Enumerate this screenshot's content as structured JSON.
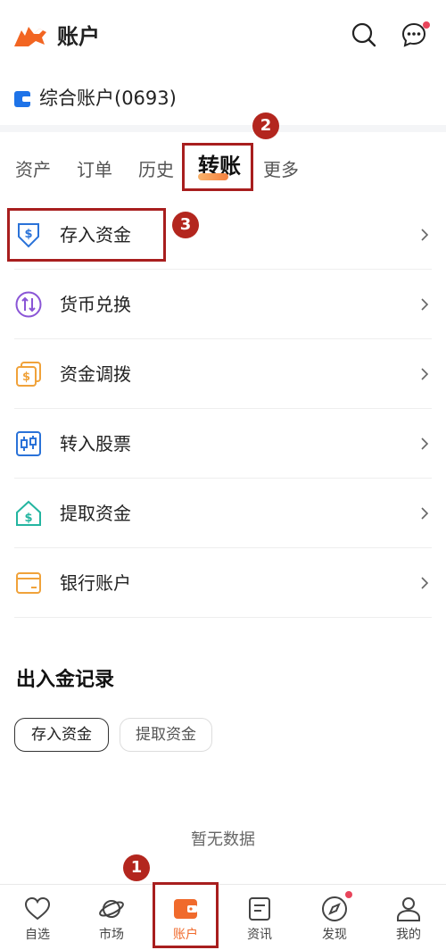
{
  "header": {
    "title": "账户",
    "search_icon": "search-icon",
    "message_icon": "message-icon"
  },
  "account": {
    "name": "综合账户(0693)",
    "icon": "wallet-icon",
    "icon_color": "#1e73e8"
  },
  "tabs": [
    {
      "label": "资产"
    },
    {
      "label": "订单"
    },
    {
      "label": "历史"
    },
    {
      "label": "转账",
      "active": true
    },
    {
      "label": "更多"
    }
  ],
  "list": [
    {
      "label": "存入资金",
      "icon": "deposit-icon",
      "color": "#2a72d8"
    },
    {
      "label": "货币兑换",
      "icon": "currency-exchange-icon",
      "color": "#8a55d6"
    },
    {
      "label": "资金调拨",
      "icon": "fund-transfer-icon",
      "color": "#f0a23a"
    },
    {
      "label": "转入股票",
      "icon": "stock-transfer-icon",
      "color": "#2a72d8"
    },
    {
      "label": "提取资金",
      "icon": "withdraw-icon",
      "color": "#23b5a0"
    },
    {
      "label": "银行账户",
      "icon": "bank-card-icon",
      "color": "#f0a23a"
    }
  ],
  "records": {
    "title": "出入金记录",
    "filters": [
      "存入资金",
      "提取资金"
    ],
    "empty_text": "暂无数据"
  },
  "bottom_nav": [
    {
      "label": "自选",
      "icon": "heart-icon"
    },
    {
      "label": "市场",
      "icon": "planet-icon"
    },
    {
      "label": "账户",
      "icon": "wallet-icon",
      "active": true
    },
    {
      "label": "资讯",
      "icon": "news-icon"
    },
    {
      "label": "发现",
      "icon": "compass-icon"
    },
    {
      "label": "我的",
      "icon": "profile-icon"
    }
  ],
  "annotations": [
    "1",
    "2",
    "3"
  ],
  "colors": {
    "accent": "#f06a2c",
    "annotation": "#a81e1e",
    "notification_dot": "#e8455b"
  }
}
